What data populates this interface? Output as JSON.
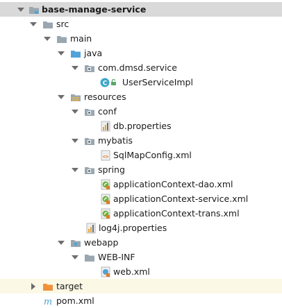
{
  "tree": {
    "root": "base-manage-service",
    "src": "src",
    "main": "main",
    "java": "java",
    "package": "com.dmsd.service",
    "class_file": "UserServiceImpl",
    "resources": "resources",
    "conf": "conf",
    "db_props": "db.properties",
    "mybatis": "mybatis",
    "sqlmap": "SqlMapConfig.xml",
    "spring": "spring",
    "ctx_dao": "applicationContext-dao.xml",
    "ctx_service": "applicationContext-service.xml",
    "ctx_trans": "applicationContext-trans.xml",
    "log4j": "log4j.properties",
    "webapp": "webapp",
    "webinf": "WEB-INF",
    "webxml": "web.xml",
    "target": "target",
    "pom": "pom.xml"
  },
  "icons": {
    "folder": "folder-icon",
    "source_folder": "source-folder-icon",
    "resources_folder": "resources-folder-icon",
    "package": "package-icon",
    "class": "class-icon",
    "properties": "properties-file-icon",
    "xml": "xml-file-icon",
    "spring_xml": "spring-xml-icon",
    "web_folder": "web-folder-icon",
    "excluded_folder": "excluded-folder-icon",
    "maven": "maven-icon"
  },
  "colors": {
    "selection": "#d9d9d9",
    "highlight_row": "#fbf9e6",
    "folder_gray": "#9aa7b0",
    "source_blue": "#4fa3d9",
    "target_orange": "#f0913a",
    "class_teal": "#3ca7c9"
  }
}
